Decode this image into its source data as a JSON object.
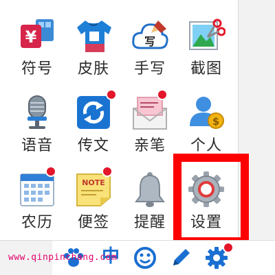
{
  "menu": {
    "items": [
      {
        "label": "符号",
        "icon": "symbol-keyboard-icon"
      },
      {
        "label": "皮肤",
        "icon": "tshirt-skin-icon"
      },
      {
        "label": "手写",
        "icon": "handwriting-cloud-icon"
      },
      {
        "label": "截图",
        "icon": "screenshot-scissors-icon"
      },
      {
        "label": "语音",
        "icon": "microphone-icon"
      },
      {
        "label": "传文",
        "icon": "transfer-arrows-icon"
      },
      {
        "label": "亲笔",
        "icon": "envelope-letter-icon"
      },
      {
        "label": "个人",
        "icon": "user-coin-icon"
      },
      {
        "label": "农历",
        "icon": "calendar-icon"
      },
      {
        "label": "便签",
        "icon": "sticky-note-icon"
      },
      {
        "label": "提醒",
        "icon": "bell-icon"
      },
      {
        "label": "设置",
        "icon": "gear-icon"
      }
    ]
  },
  "toolbar": {
    "mode_label": "中",
    "buttons": [
      "paw-icon",
      "smiley-icon",
      "pen-icon",
      "gear-icon"
    ]
  },
  "watermark": "www.qinpinchang.com",
  "colors": {
    "badge": "#e3162a",
    "highlight": "#ff0000",
    "toolbar_accent": "#1a6fd1",
    "watermark": "#e0006a"
  }
}
